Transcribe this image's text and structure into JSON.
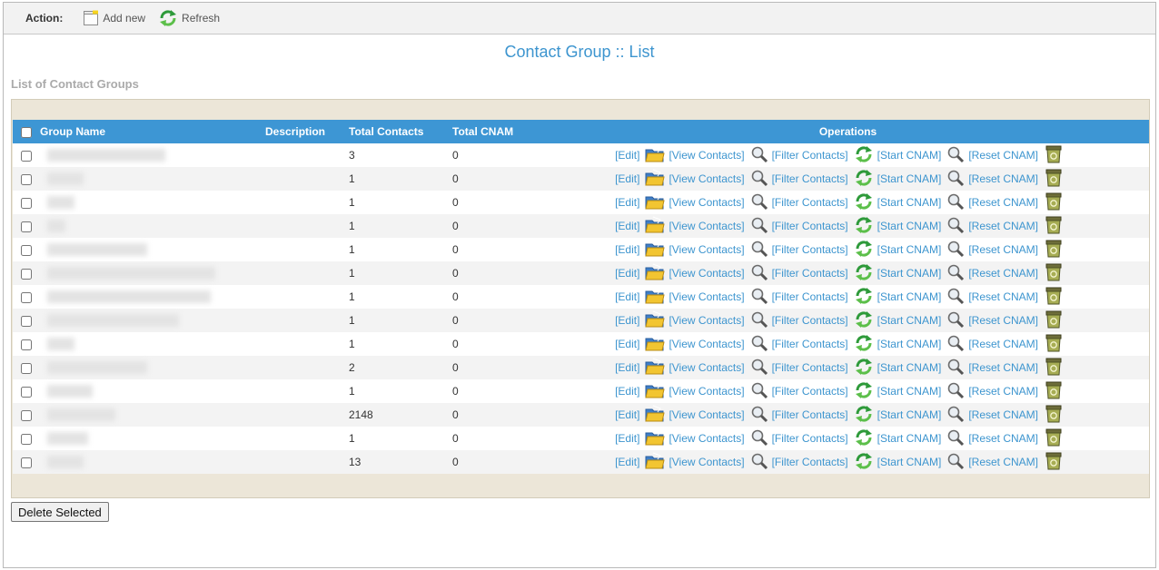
{
  "toolbar": {
    "action_label": "Action:",
    "add_new_label": "Add new",
    "refresh_label": "Refresh"
  },
  "page_title": "Contact Group :: List",
  "section_title": "List of Contact Groups",
  "table": {
    "headers": {
      "group_name": "Group Name",
      "description": "Description",
      "total_contacts": "Total Contacts",
      "total_cnam": "Total CNAM",
      "operations": "Operations"
    },
    "operation_labels": {
      "edit": "[Edit]",
      "view_contacts": "[View Contacts]",
      "filter_contacts": "[Filter Contacts]",
      "start_cnam": "[Start CNAM]",
      "reset_cnam": "[Reset CNAM]"
    },
    "rows": [
      {
        "total_contacts": "3",
        "total_cnam": "0"
      },
      {
        "total_contacts": "1",
        "total_cnam": "0"
      },
      {
        "total_contacts": "1",
        "total_cnam": "0"
      },
      {
        "total_contacts": "1",
        "total_cnam": "0"
      },
      {
        "total_contacts": "1",
        "total_cnam": "0"
      },
      {
        "total_contacts": "1",
        "total_cnam": "0"
      },
      {
        "total_contacts": "1",
        "total_cnam": "0"
      },
      {
        "total_contacts": "1",
        "total_cnam": "0"
      },
      {
        "total_contacts": "1",
        "total_cnam": "0"
      },
      {
        "total_contacts": "2",
        "total_cnam": "0"
      },
      {
        "total_contacts": "1",
        "total_cnam": "0"
      },
      {
        "total_contacts": "2148",
        "total_cnam": "0"
      },
      {
        "total_contacts": "1",
        "total_cnam": "0"
      },
      {
        "total_contacts": "13",
        "total_cnam": "0"
      }
    ]
  },
  "delete_button_label": "Delete Selected",
  "icons": {
    "add_new": "note-icon",
    "refresh": "refresh-icon",
    "view_contacts": "folder-icon",
    "filter_contacts": "magnifier-icon",
    "start_cnam": "refresh-icon",
    "reset_cnam": "magnifier-icon",
    "delete": "recycle-bin-icon"
  },
  "colors": {
    "accent": "#3d95cf",
    "header_bg": "#3d96d4",
    "panel_bg": "#ece6d8"
  }
}
